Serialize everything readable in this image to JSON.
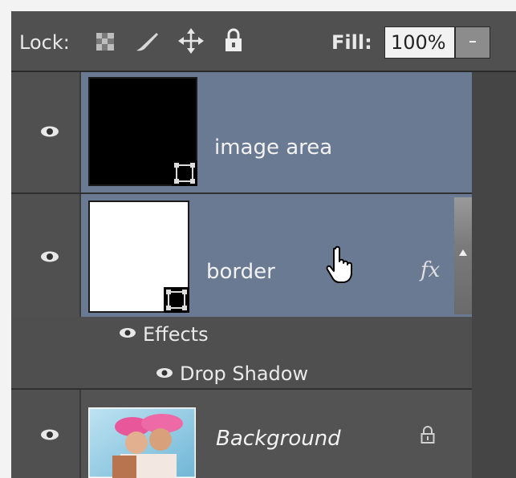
{
  "lock_bar": {
    "lock_label": "Lock:",
    "icons": [
      "lock-transparent-pixels-icon",
      "lock-image-pixels-icon",
      "lock-position-icon",
      "lock-all-icon"
    ],
    "fill_label": "Fill:",
    "fill_value": "100%"
  },
  "layers": [
    {
      "name": "image area",
      "selected": true,
      "thumbnail": "black-with-mask-icon"
    },
    {
      "name": "border",
      "selected": true,
      "thumbnail": "white-with-mask-icon",
      "fx_label": "fx"
    },
    {
      "name": "Background",
      "selected": false,
      "thumbnail": "photo",
      "locked": true
    }
  ],
  "effects": {
    "label": "Effects",
    "items": [
      "Drop Shadow"
    ]
  },
  "colors": {
    "selected_row": "#6b7a93",
    "panel_bg": "#4a4a4a",
    "text": "#f2f2f2"
  }
}
